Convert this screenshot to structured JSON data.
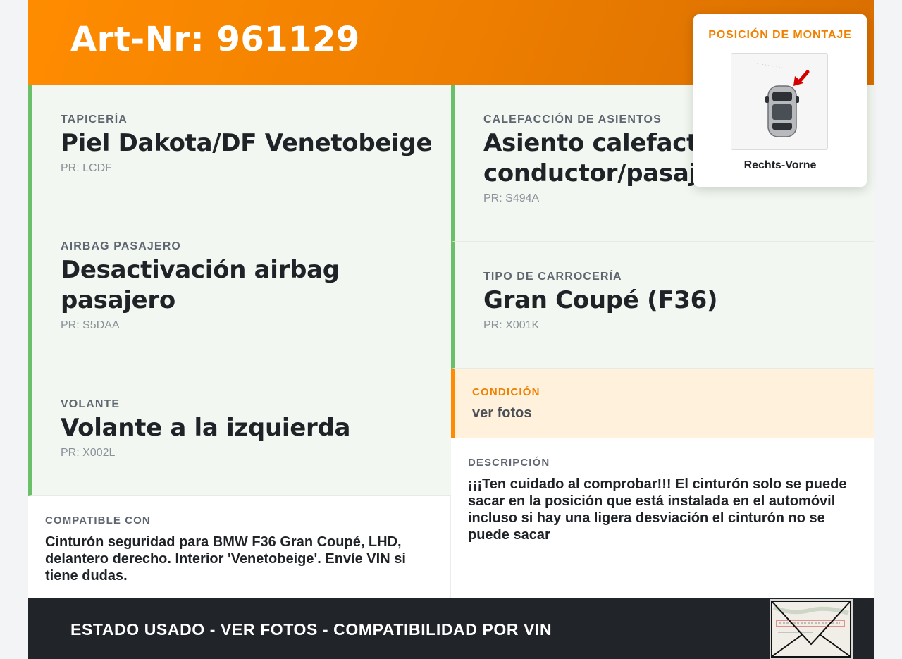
{
  "header": {
    "title": "Art-Nr: 961129"
  },
  "specs": {
    "tapiceria": {
      "label": "TAPICERÍA",
      "value": "Piel Dakota/DF Venetobeige",
      "code": "PR: LCDF"
    },
    "calefaccion": {
      "label": "CALEFACCIÓN DE ASIENTOS",
      "value": "Asiento calefactable conductor/pasajero",
      "code": "PR: S494A"
    },
    "airbag": {
      "label": "AIRBAG PASAJERO",
      "value": "Desactivación airbag pasajero",
      "code": "PR: S5DAA"
    },
    "carroceria": {
      "label": "TIPO DE CARROCERÍA",
      "value": "Gran Coupé (F36)",
      "code": "PR: X001K"
    },
    "volante": {
      "label": "VOLANTE",
      "value": "Volante a la izquierda",
      "code": "PR: X002L"
    }
  },
  "condition": {
    "label": "CONDICIÓN",
    "value": "ver fotos"
  },
  "compatible": {
    "label": "COMPATIBLE CON",
    "text": "Cinturón seguridad para BMW F36 Gran Coupé, LHD, delantero derecho. Interior 'Venetobeige'. Envíe VIN si tiene dudas."
  },
  "description": {
    "label": "DESCRIPCIÓN",
    "text": "¡¡¡Ten cuidado al comprobar!!! El cinturón solo se puede sacar en la posición que está instalada en el automóvil incluso si hay una ligera desviación el cinturón no se puede sacar"
  },
  "mounting": {
    "title": "POSICIÓN DE MONTAJE",
    "position": "Rechts-Vorne"
  },
  "footer": {
    "text": "ESTADO USADO - VER FOTOS - COMPATIBILIDAD POR VIN"
  },
  "colors": {
    "accent": "#ff8c00",
    "green_border": "#6abf69",
    "footer_bg": "#212429"
  }
}
